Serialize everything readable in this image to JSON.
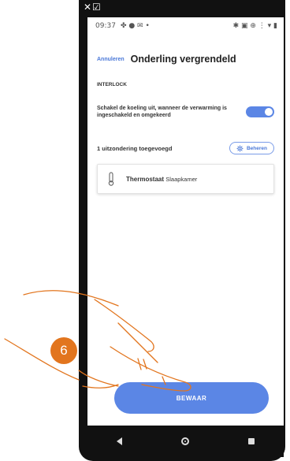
{
  "statusbar": {
    "time": "09:37",
    "left_icons": "✤ ● ✉ •",
    "right_icons": "✱ ▣ ⊕ ⋮ ▾ ▮"
  },
  "topbar_icons": "✕☑",
  "header": {
    "cancel_label": "Annuleren",
    "title": "Onderling vergrendeld"
  },
  "section": {
    "label": "INTERLOCK"
  },
  "setting": {
    "text": "Schakel de koeling uit, wanneer de verwarming is ingeschakeld en omgekeerd",
    "toggle_on": true
  },
  "exceptions": {
    "count_text": "1 uitzondering toegevoegd",
    "manage_label": "Beheren"
  },
  "card": {
    "device_type": "Thermostaat",
    "room": "Slaapkamer"
  },
  "save_label": "BEWAAR",
  "step_badge": "6",
  "colors": {
    "accent": "#5b86e5",
    "badge": "#e2751e"
  }
}
